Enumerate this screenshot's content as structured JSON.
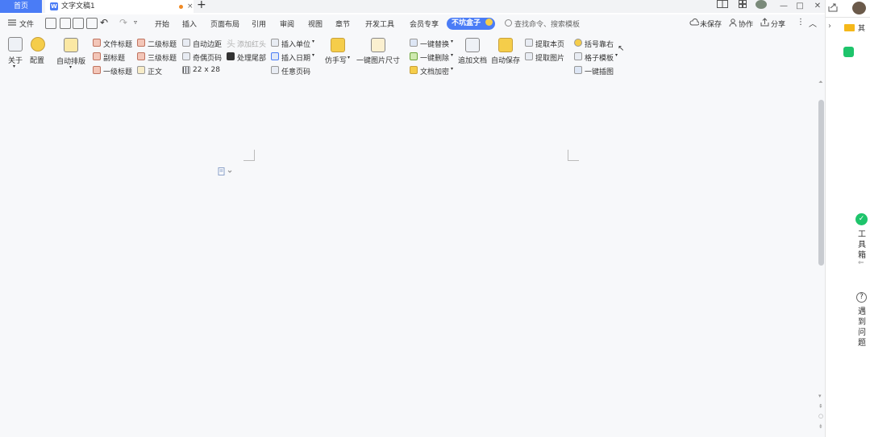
{
  "titlebar": {
    "home_tab": "首页",
    "doc_tab": "文字文稿1",
    "new_tab": "+",
    "close_tab": "×",
    "window_controls": [
      "—",
      "□",
      "✕"
    ]
  },
  "menubar": {
    "file": "文件",
    "items": [
      "开始",
      "插入",
      "页面布局",
      "引用",
      "审阅",
      "视图",
      "章节",
      "开发工具",
      "会员专享"
    ],
    "special_tab": "不坑盒子",
    "search_placeholder": "查找命令、搜索模板",
    "unsaved": "未保存",
    "collaborate": "协作",
    "share": "分享"
  },
  "ribbon": {
    "about": "关于",
    "config": "配置",
    "auto_layout": "自动排版",
    "doc_title": "文件标题",
    "subtitle": "副标题",
    "heading1": "一级标题",
    "heading2": "二级标题",
    "heading3": "三级标题",
    "body": "正文",
    "auto_margin": "自动边距",
    "odd_even_page": "奇偶页码",
    "grid": "22 x 28",
    "add_header": "添加红头",
    "handle_tail": "处理尾部",
    "insert_unit": "插入单位",
    "insert_date": "插入日期",
    "any_page": "任意页码",
    "handwrite": "仿手写",
    "image_size": "一键图片尺寸",
    "replace": "一键替换",
    "delete": "一键删除",
    "encrypt": "文档加密",
    "append_doc": "追加文档",
    "auto_save": "自动保存",
    "extract_page": "提取本页",
    "extract_image": "提取图片",
    "bracket": "括号靠右",
    "grid_template": "格子模板",
    "one_click_chart": "一键插图"
  },
  "rightpanel": {
    "folder_label": "其",
    "toolbox": [
      "工",
      "具",
      "箱"
    ],
    "help": [
      "遇",
      "到",
      "问",
      "题"
    ],
    "help_icon": "?"
  },
  "colors": {
    "accent": "#4a7cf6",
    "green": "#1ec46b",
    "tab_dot": "#f08a24"
  }
}
